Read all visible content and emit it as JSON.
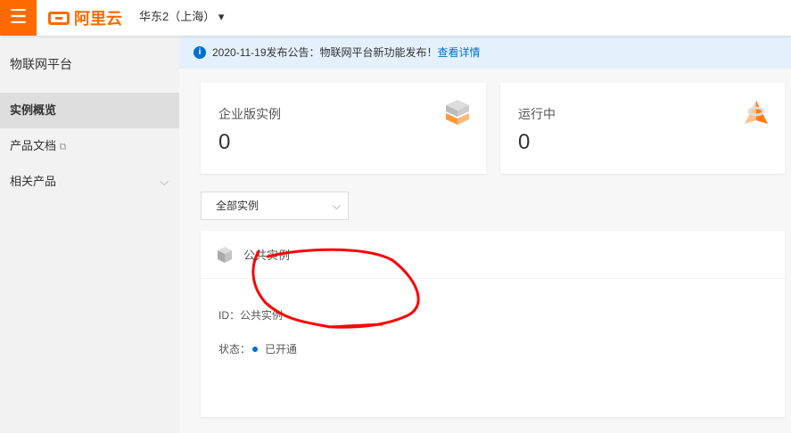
{
  "header": {
    "menu_icon": "☰",
    "brand": "阿里云",
    "region": "华东2（上海）",
    "region_caret": "▾"
  },
  "sidebar": {
    "title": "物联网平台",
    "items": [
      {
        "label": "实例概览"
      },
      {
        "label": "产品文档",
        "ext": "⧉"
      },
      {
        "label": "相关产品",
        "chevron": "⌵"
      }
    ]
  },
  "notice": {
    "text": "2020-11-19发布公告：物联网平台新功能发布！",
    "link": "查看详情"
  },
  "cards": [
    {
      "label": "企业版实例",
      "value": "0"
    },
    {
      "label": "运行中",
      "value": "0"
    }
  ],
  "filter": {
    "value": "全部实例"
  },
  "panel": {
    "title": "公共实例",
    "id_label": "ID：",
    "id_value": "公共实例",
    "status_label": "状态：",
    "status_value": "已开通"
  },
  "colors": {
    "accent": "#ff6a00",
    "link": "#0070cc",
    "annotation": "#ff0000"
  }
}
